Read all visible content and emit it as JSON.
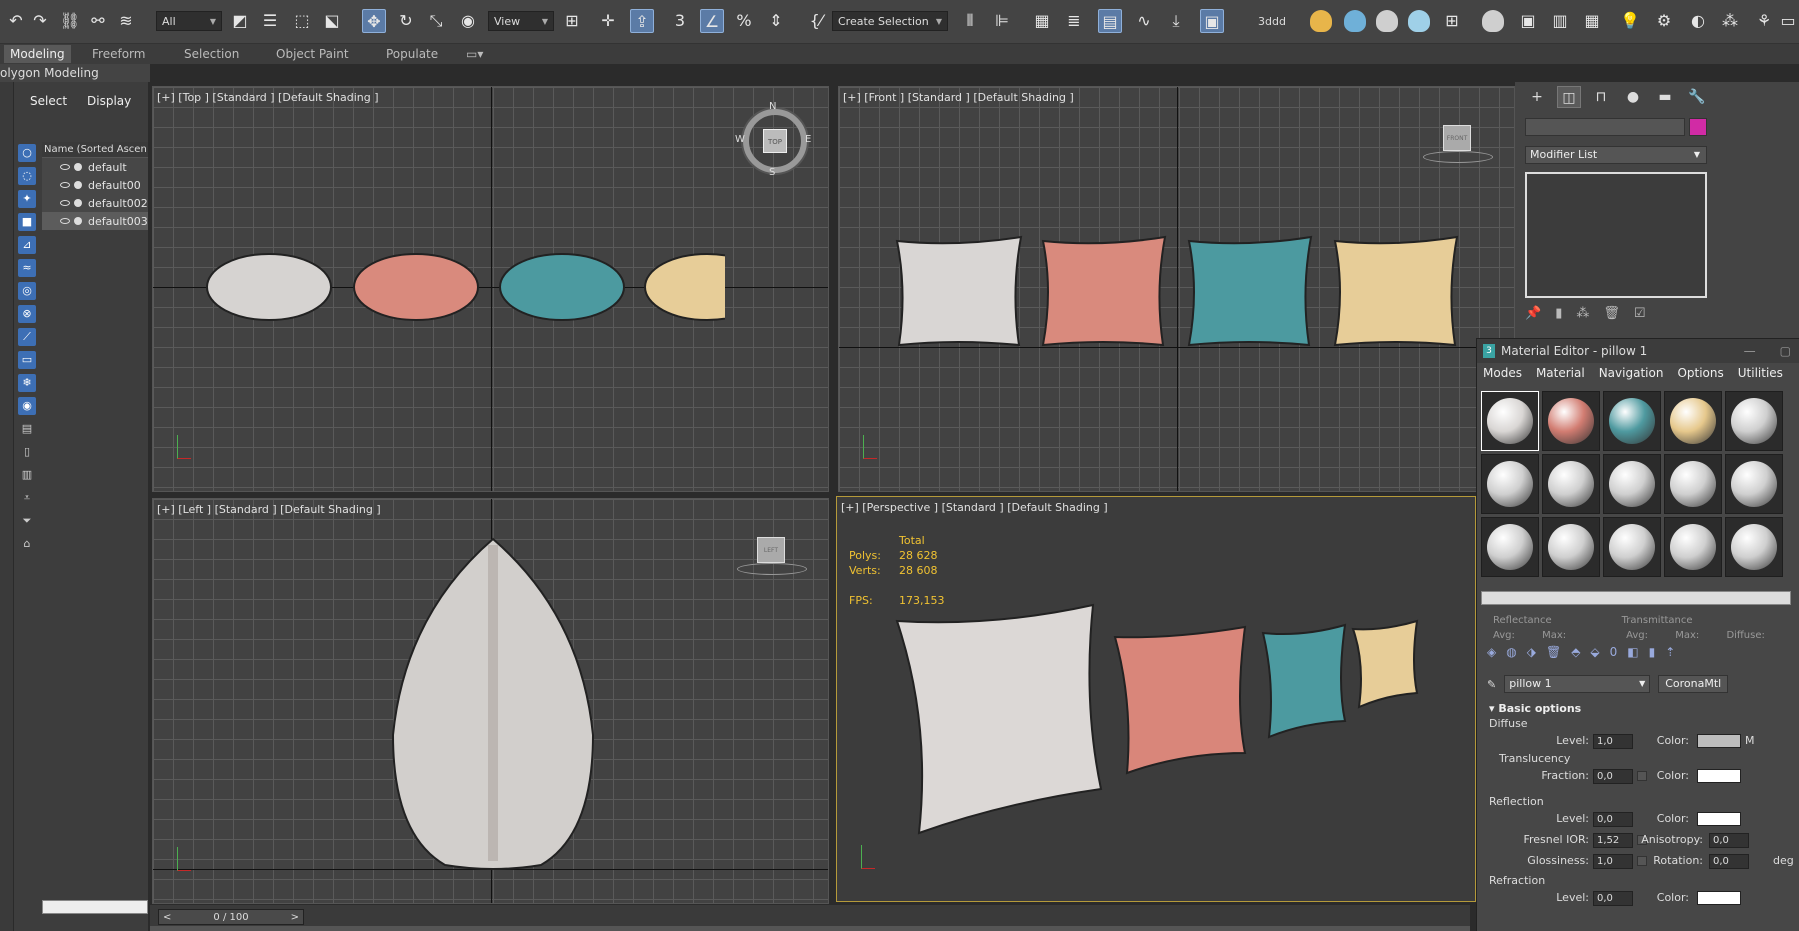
{
  "toolbar": {
    "filter": "All",
    "reference_coord": "View",
    "selection_set": "Create Selection Se",
    "workspace_label": "3ddd",
    "icons": [
      "undo-icon",
      "redo-icon",
      "link-icon",
      "unlink-icon",
      "bind-space-warp-icon",
      "select-object-icon",
      "select-by-name-icon",
      "rect-selection-icon",
      "window-crossing-icon",
      "select-move-icon",
      "select-rotate-icon",
      "select-scale-icon",
      "select-place-icon",
      "pivot-icon",
      "snap-toggle-icon",
      "angle-snap-icon",
      "percent-snap-icon",
      "spinner-snap-icon",
      "named-selection-icon",
      "mirror-icon",
      "align-icon",
      "scene-explorer-icon",
      "layer-explorer-icon",
      "ribbon-icon",
      "curve-editor-icon",
      "schematic-view-icon",
      "material-editor-icon",
      "render-setup-icon",
      "render-frame-icon",
      "render-icon"
    ]
  },
  "ribbon": {
    "tabs": [
      "Modeling",
      "Freeform",
      "Selection",
      "Object Paint",
      "Populate"
    ],
    "active_tab": "Modeling",
    "subpanel": "olygon Modeling"
  },
  "explorer": {
    "tabs": [
      "Select",
      "Display"
    ],
    "column_header": "Name (Sorted Ascen",
    "items": [
      "default",
      "default00",
      "default002",
      "default003"
    ],
    "selected_index": 3
  },
  "viewports": {
    "top": {
      "label": "[+] [Top ] [Standard ] [Default Shading ]",
      "compass": {
        "n": "N",
        "s": "S",
        "e": "E",
        "w": "W",
        "cube": "TOP"
      }
    },
    "front": {
      "label": "[+] [Front ] [Standard ] [Default Shading ]",
      "cube": "FRONT"
    },
    "left": {
      "label": "[+] [Left ] [Standard ] [Default Shading ]",
      "cube": "LEFT"
    },
    "perspective": {
      "label": "[+] [Perspective ] [Standard ] [Default Shading ]",
      "stats": {
        "header": "Total",
        "polys_label": "Polys:",
        "polys": "28 628",
        "verts_label": "Verts:",
        "verts": "28 608",
        "fps_label": "FPS:",
        "fps": "173,153"
      }
    }
  },
  "timeline": {
    "position": "0 / 100",
    "prev": "<",
    "next": ">"
  },
  "command_panel": {
    "modifier_list": "Modifier List",
    "object_color": "#d12ba5",
    "tabs": [
      "create-icon",
      "modify-icon",
      "hierarchy-icon",
      "motion-icon",
      "display-icon",
      "utilities-icon"
    ]
  },
  "material_editor": {
    "title": "Material Editor - pillow 1",
    "menu": [
      "Modes",
      "Material",
      "Navigation",
      "Options",
      "Utilities"
    ],
    "slots": [
      {
        "color": "#d9d6d4"
      },
      {
        "color": "#d27d72"
      },
      {
        "color": "#4f9aa0"
      },
      {
        "color": "#e6c88c"
      },
      {
        "color": "#cfcfcf"
      },
      {
        "color": "#cfcfcf"
      },
      {
        "color": "#cfcfcf"
      },
      {
        "color": "#cfcfcf"
      },
      {
        "color": "#cfcfcf"
      },
      {
        "color": "#cfcfcf"
      },
      {
        "color": "#cfcfcf"
      },
      {
        "color": "#cfcfcf"
      },
      {
        "color": "#cfcfcf"
      },
      {
        "color": "#cfcfcf"
      },
      {
        "color": "#cfcfcf"
      }
    ],
    "info": {
      "reflectance": "Reflectance",
      "transmittance": "Transmittance",
      "avg": "Avg:",
      "max": "Max:",
      "diffuse": "Diffuse:"
    },
    "material_name": "pillow 1",
    "material_type": "CoronaMtl",
    "basic_options": "Basic options",
    "diffuse": {
      "head": "Diffuse",
      "level_label": "Level:",
      "level": "1,0",
      "color_label": "Color:",
      "color": "#bdbdbd",
      "map": "M"
    },
    "translucency": {
      "head": "Translucency",
      "fraction_label": "Fraction:",
      "fraction": "0,0",
      "color_label": "Color:",
      "color": "#ffffff"
    },
    "reflection": {
      "head": "Reflection",
      "level_label": "Level:",
      "level": "0,0",
      "color_label": "Color:",
      "color": "#ffffff",
      "ior_label": "Fresnel IOR:",
      "ior": "1,52",
      "aniso_label": "Anisotropy:",
      "aniso": "0,0",
      "gloss_label": "Glossiness:",
      "gloss": "1,0",
      "rot_label": "Rotation:",
      "rot": "0,0",
      "rot_unit": "deg"
    },
    "refraction": {
      "head": "Refraction",
      "level_label": "Level:",
      "level": "0,0",
      "color_label": "Color:",
      "color": "#ffffff"
    }
  },
  "pillow_colors": {
    "white": "#d9d6d4",
    "pink": "#d98a7d",
    "teal": "#4c9aa0",
    "yellow": "#e7cd98"
  }
}
